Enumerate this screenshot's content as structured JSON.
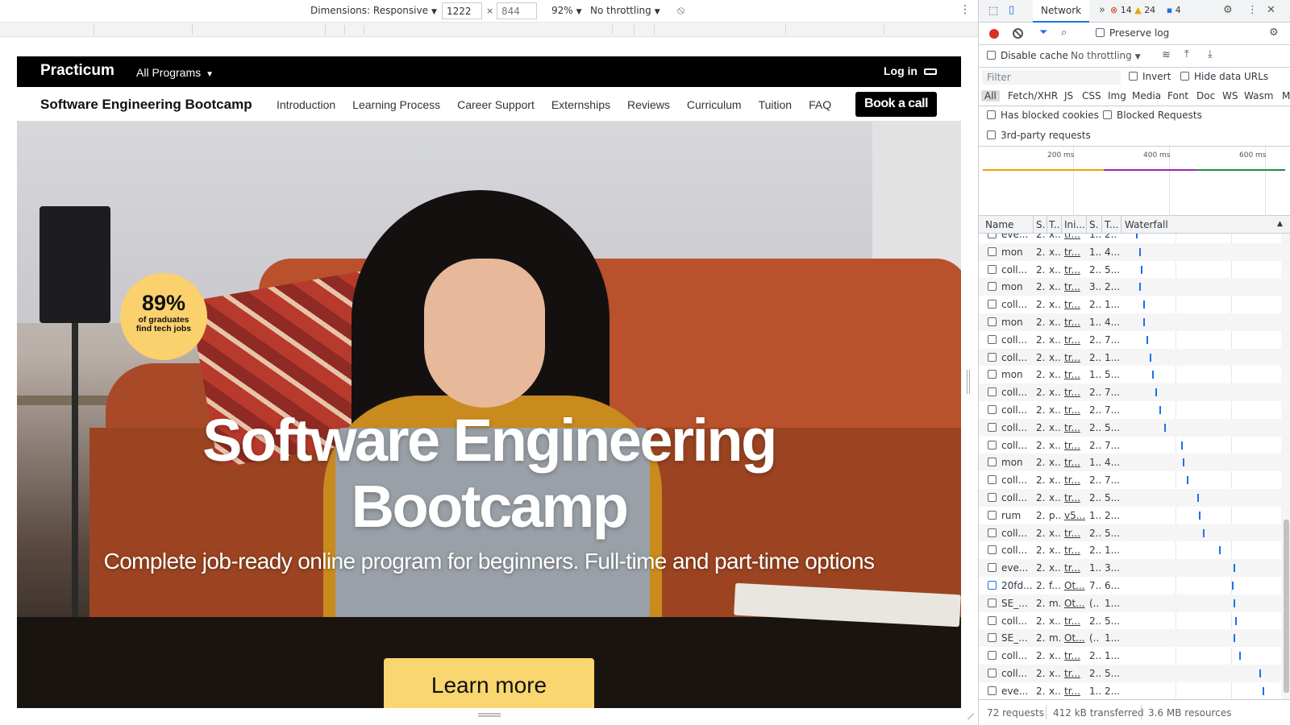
{
  "device_toolbar": {
    "dimensions_label": "Dimensions: Responsive",
    "width_value": "1222",
    "height_placeholder": "844",
    "times": "×",
    "zoom": "92%",
    "throttling": "No throttling"
  },
  "site": {
    "brand": "Practicum",
    "all_programs": "All Programs",
    "login": "Log in",
    "subnav_title": "Software Engineering Bootcamp",
    "subnav_links": [
      "Introduction",
      "Learning Process",
      "Career Support",
      "Externships",
      "Reviews",
      "Curriculum",
      "Tuition",
      "FAQ"
    ],
    "book_call": "Book a call",
    "badge_pct": "89%",
    "badge_caption": "of graduates find tech jobs",
    "hero_title_line1": "Software Engineering",
    "hero_title_line2": "Bootcamp",
    "hero_sub": "Complete job-ready online program for beginners. Full-time and part-time options",
    "learn_more": "Learn more"
  },
  "devtools": {
    "tab_network": "Network",
    "more_tabs": "»",
    "errors": "14",
    "warnings": "24",
    "messages": "4",
    "preserve_log": "Preserve log",
    "disable_cache": "Disable cache",
    "throttling": "No throttling",
    "filter_placeholder": "Filter",
    "invert": "Invert",
    "hide_data_urls": "Hide data URLs",
    "types": [
      "All",
      "Fetch/XHR",
      "JS",
      "CSS",
      "Img",
      "Media",
      "Font",
      "Doc",
      "WS",
      "Wasm",
      "M"
    ],
    "has_blocked_cookies": "Has blocked cookies",
    "blocked_requests": "Blocked Requests",
    "third_party": "3rd-party requests",
    "overview_ticks": [
      "200 ms",
      "400 ms",
      "600 ms"
    ],
    "columns": [
      "Name",
      "S.",
      "T..",
      "Ini...",
      "S.",
      "T...",
      "Waterfall"
    ],
    "rows": [
      {
        "name": "eve...",
        "s": "2..",
        "t": "x..",
        "ini": "tr...",
        "sz": "1..",
        "tm": "2..",
        "wf": 0.08
      },
      {
        "name": "mon",
        "s": "2..",
        "t": "x..",
        "ini": "tr...",
        "sz": "1..",
        "tm": "4...",
        "wf": 0.1
      },
      {
        "name": "coll...",
        "s": "2..",
        "t": "x..",
        "ini": "tr...",
        "sz": "2..",
        "tm": "5...",
        "wf": 0.11
      },
      {
        "name": "mon",
        "s": "2..",
        "t": "x..",
        "ini": "tr...",
        "sz": "3..",
        "tm": "2...",
        "wf": 0.1
      },
      {
        "name": "coll...",
        "s": "2..",
        "t": "x..",
        "ini": "tr...",
        "sz": "2..",
        "tm": "1...",
        "wf": 0.13
      },
      {
        "name": "mon",
        "s": "2..",
        "t": "x..",
        "ini": "tr...",
        "sz": "1..",
        "tm": "4...",
        "wf": 0.13
      },
      {
        "name": "coll...",
        "s": "2..",
        "t": "x..",
        "ini": "tr...",
        "sz": "2..",
        "tm": "7...",
        "wf": 0.15
      },
      {
        "name": "coll...",
        "s": "2..",
        "t": "x..",
        "ini": "tr...",
        "sz": "2..",
        "tm": "1...",
        "wf": 0.17
      },
      {
        "name": "mon",
        "s": "2..",
        "t": "x..",
        "ini": "tr...",
        "sz": "1..",
        "tm": "5...",
        "wf": 0.19
      },
      {
        "name": "coll...",
        "s": "2..",
        "t": "x..",
        "ini": "tr...",
        "sz": "2..",
        "tm": "7...",
        "wf": 0.21
      },
      {
        "name": "coll...",
        "s": "2..",
        "t": "x..",
        "ini": "tr...",
        "sz": "2..",
        "tm": "7...",
        "wf": 0.24
      },
      {
        "name": "coll...",
        "s": "2..",
        "t": "x..",
        "ini": "tr...",
        "sz": "2..",
        "tm": "5...",
        "wf": 0.27
      },
      {
        "name": "coll...",
        "s": "2..",
        "t": "x..",
        "ini": "tr...",
        "sz": "2..",
        "tm": "7...",
        "wf": 0.39
      },
      {
        "name": "mon",
        "s": "2..",
        "t": "x..",
        "ini": "tr...",
        "sz": "1..",
        "tm": "4...",
        "wf": 0.4
      },
      {
        "name": "coll...",
        "s": "2..",
        "t": "x..",
        "ini": "tr...",
        "sz": "2..",
        "tm": "7...",
        "wf": 0.43
      },
      {
        "name": "coll...",
        "s": "2..",
        "t": "x..",
        "ini": "tr...",
        "sz": "2..",
        "tm": "5...",
        "wf": 0.5
      },
      {
        "name": "rum",
        "s": "2..",
        "t": "p..",
        "ini": "v5...",
        "sz": "1..",
        "tm": "2...",
        "wf": 0.51
      },
      {
        "name": "coll...",
        "s": "2..",
        "t": "x..",
        "ini": "tr...",
        "sz": "2..",
        "tm": "5...",
        "wf": 0.54
      },
      {
        "name": "coll...",
        "s": "2..",
        "t": "x..",
        "ini": "tr...",
        "sz": "2..",
        "tm": "1...",
        "wf": 0.65
      },
      {
        "name": "eve...",
        "s": "2..",
        "t": "x..",
        "ini": "tr...",
        "sz": "1..",
        "tm": "3...",
        "wf": 0.75
      },
      {
        "name": "20fd...",
        "s": "2..",
        "t": "f...",
        "ini": "Ot...",
        "sz": "7..",
        "tm": "6...",
        "wf": 0.74,
        "doc": true
      },
      {
        "name": "SE_...",
        "s": "2..",
        "t": "m..",
        "ini": "Ot...",
        "sz": "(..",
        "tm": "1...",
        "wf": 0.75
      },
      {
        "name": "coll...",
        "s": "2..",
        "t": "x..",
        "ini": "tr...",
        "sz": "2..",
        "tm": "5...",
        "wf": 0.76
      },
      {
        "name": "SE_...",
        "s": "2..",
        "t": "m..",
        "ini": "Ot...",
        "sz": "(..",
        "tm": "1...",
        "wf": 0.75
      },
      {
        "name": "coll...",
        "s": "2..",
        "t": "x..",
        "ini": "tr...",
        "sz": "2..",
        "tm": "1...",
        "wf": 0.79
      },
      {
        "name": "coll...",
        "s": "2..",
        "t": "x..",
        "ini": "tr...",
        "sz": "2..",
        "tm": "5...",
        "wf": 0.93
      },
      {
        "name": "eve...",
        "s": "2..",
        "t": "x..",
        "ini": "tr...",
        "sz": "1..",
        "tm": "2...",
        "wf": 0.95
      }
    ],
    "status_requests": "72 requests",
    "status_transferred": "412 kB transferred",
    "status_resources": "3.6 MB resources"
  },
  "colors": {
    "accent": "#1a73e8",
    "record": "#d93025",
    "cta_yellow": "#f9d66f",
    "badge_yellow": "#fbd16d"
  }
}
